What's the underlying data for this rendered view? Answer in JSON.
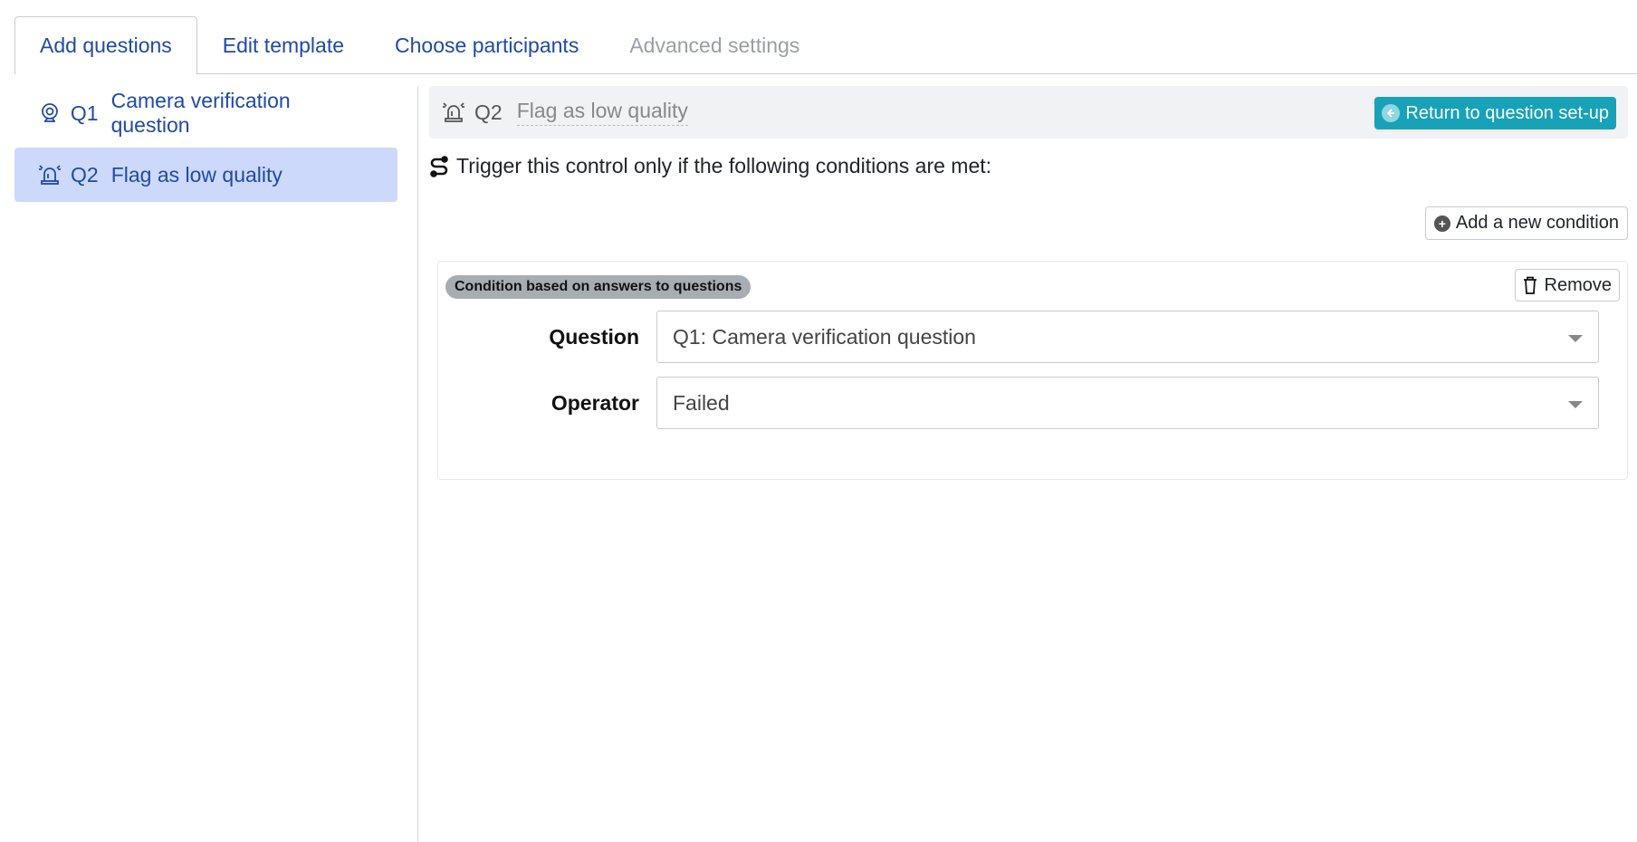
{
  "tabs": [
    {
      "label": "Add questions",
      "state": "active"
    },
    {
      "label": "Edit template",
      "state": "normal"
    },
    {
      "label": "Choose participants",
      "state": "normal"
    },
    {
      "label": "Advanced settings",
      "state": "disabled"
    }
  ],
  "sidebar": {
    "items": [
      {
        "num": "Q1",
        "label": "Camera verification question",
        "icon": "camera-icon",
        "active": false
      },
      {
        "num": "Q2",
        "label": "Flag as low quality",
        "icon": "alarm-siren-icon",
        "active": true
      }
    ]
  },
  "question_header": {
    "icon": "alarm-siren-icon",
    "num": "Q2",
    "title": "Flag as low quality",
    "return_label": "Return to question set-up"
  },
  "trigger": {
    "icon": "route-icon",
    "text": "Trigger this control only if the following conditions are met:"
  },
  "add_condition_label": "Add a new condition",
  "condition": {
    "badge": "Condition based on answers to questions",
    "remove_label": "Remove",
    "question_label": "Question",
    "question_value": "Q1: Camera verification question",
    "operator_label": "Operator",
    "operator_value": "Failed"
  },
  "colors": {
    "link": "#1f4aa8",
    "active_bg": "#cdd9fb",
    "accent": "#17a2b8"
  }
}
